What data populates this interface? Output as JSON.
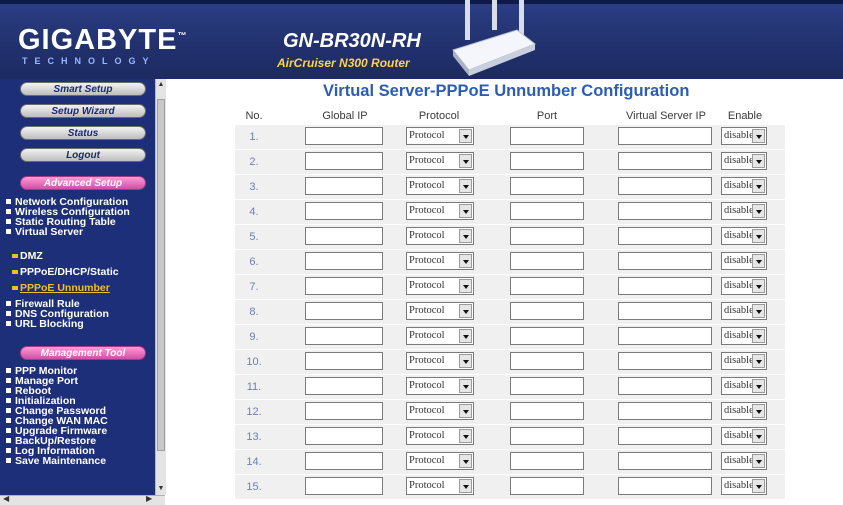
{
  "header": {
    "brand": "GIGABYTE",
    "brand_tm": "™",
    "brand_sub": "TECHNOLOGY",
    "model": "GN-BR30N-RH",
    "model_sub": "AirCruiser N300 Router"
  },
  "sidebar": {
    "buttons": [
      "Smart Setup",
      "Setup Wizard",
      "Status",
      "Logout"
    ],
    "advanced_label": "Advanced Setup",
    "advanced_items": [
      "Network Configuration",
      "Wireless Configuration",
      "Static Routing Table",
      "Virtual Server"
    ],
    "virtual_subitems": [
      "DMZ",
      "PPPoE/DHCP/Static",
      "PPPoE Unnumber"
    ],
    "advanced_items_2": [
      "Firewall Rule",
      "DNS Configuration",
      "URL Blocking"
    ],
    "management_label": "Management Tool",
    "management_items": [
      "PPP Monitor",
      "Manage Port",
      "Reboot",
      "Initialization",
      "Change Password",
      "Change WAN MAC",
      "Upgrade Firmware",
      "BackUp/Restore",
      "Log Information",
      "Save Maintenance"
    ]
  },
  "main": {
    "title": "Virtual Server-PPPoE Unnumber Configuration",
    "columns": {
      "no": "No.",
      "global_ip": "Global IP",
      "protocol": "Protocol",
      "port": "Port",
      "virtual_server_ip": "Virtual Server IP",
      "enable": "Enable"
    },
    "rows": [
      {
        "no": "1.",
        "protocol": "Protocol",
        "enable": "disable"
      },
      {
        "no": "2.",
        "protocol": "Protocol",
        "enable": "disable"
      },
      {
        "no": "3.",
        "protocol": "Protocol",
        "enable": "disable"
      },
      {
        "no": "4.",
        "protocol": "Protocol",
        "enable": "disable"
      },
      {
        "no": "5.",
        "protocol": "Protocol",
        "enable": "disable"
      },
      {
        "no": "6.",
        "protocol": "Protocol",
        "enable": "disable"
      },
      {
        "no": "7.",
        "protocol": "Protocol",
        "enable": "disable"
      },
      {
        "no": "8.",
        "protocol": "Protocol",
        "enable": "disable"
      },
      {
        "no": "9.",
        "protocol": "Protocol",
        "enable": "disable"
      },
      {
        "no": "10.",
        "protocol": "Protocol",
        "enable": "disable"
      },
      {
        "no": "11.",
        "protocol": "Protocol",
        "enable": "disable"
      },
      {
        "no": "12.",
        "protocol": "Protocol",
        "enable": "disable"
      },
      {
        "no": "13.",
        "protocol": "Protocol",
        "enable": "disable"
      },
      {
        "no": "14.",
        "protocol": "Protocol",
        "enable": "disable"
      },
      {
        "no": "15.",
        "protocol": "Protocol",
        "enable": "disable"
      }
    ]
  },
  "colors": {
    "header_bg": "#22326f",
    "sidebar_bg": "#1d2f78",
    "title": "#2c5db3",
    "section_pill": "#d04fa6",
    "active_item": "#f0c020",
    "row_bg": "#f0f0f0"
  }
}
